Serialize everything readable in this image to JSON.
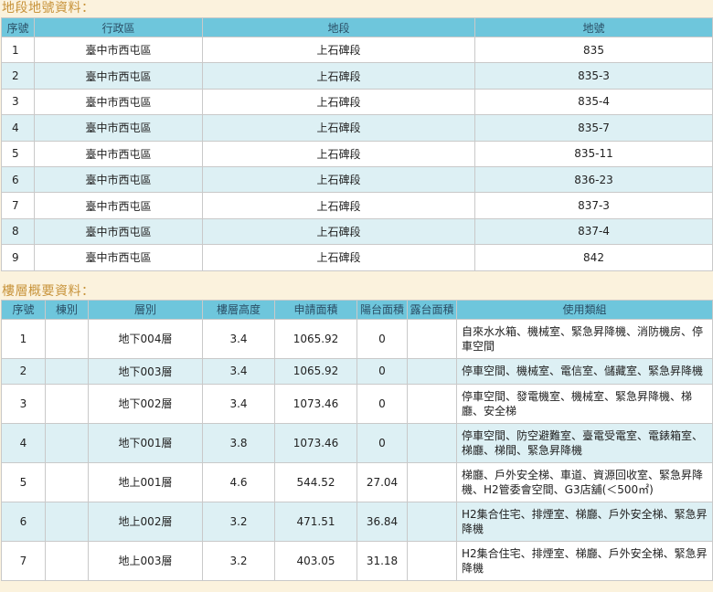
{
  "lot_section": {
    "title": "地段地號資料：",
    "headers": [
      "序號",
      "行政區",
      "地段",
      "地號"
    ],
    "rows": [
      [
        "1",
        "臺中市西屯區",
        "上石碑段",
        "835"
      ],
      [
        "2",
        "臺中市西屯區",
        "上石碑段",
        "835-3"
      ],
      [
        "3",
        "臺中市西屯區",
        "上石碑段",
        "835-4"
      ],
      [
        "4",
        "臺中市西屯區",
        "上石碑段",
        "835-7"
      ],
      [
        "5",
        "臺中市西屯區",
        "上石碑段",
        "835-11"
      ],
      [
        "6",
        "臺中市西屯區",
        "上石碑段",
        "836-23"
      ],
      [
        "7",
        "臺中市西屯區",
        "上石碑段",
        "837-3"
      ],
      [
        "8",
        "臺中市西屯區",
        "上石碑段",
        "837-4"
      ],
      [
        "9",
        "臺中市西屯區",
        "上石碑段",
        "842"
      ]
    ]
  },
  "floor_section": {
    "title": "樓層概要資料：",
    "headers": [
      "序號",
      "棟別",
      "層別",
      "樓層高度",
      "申請面積",
      "陽台面積",
      "露台面積",
      "使用類組"
    ],
    "rows": [
      [
        "1",
        "",
        "地下004層",
        "3.4",
        "1065.92",
        "0",
        "",
        "自來水水箱、機械室、緊急昇降機、消防機房、停車空間"
      ],
      [
        "2",
        "",
        "地下003層",
        "3.4",
        "1065.92",
        "0",
        "",
        "停車空間、機械室、電信室、儲藏室、緊急昇降機"
      ],
      [
        "3",
        "",
        "地下002層",
        "3.4",
        "1073.46",
        "0",
        "",
        "停車空間、發電機室、機械室、緊急昇降機、梯廳、安全梯"
      ],
      [
        "4",
        "",
        "地下001層",
        "3.8",
        "1073.46",
        "0",
        "",
        "停車空間、防空避難室、臺電受電室、電錶箱室、梯廳、梯間、緊急昇降機"
      ],
      [
        "5",
        "",
        "地上001層",
        "4.6",
        "544.52",
        "27.04",
        "",
        "梯廳、戶外安全梯、車道、資源回收室、緊急昇降機、H2管委會空間、G3店舖(＜500㎡)"
      ],
      [
        "6",
        "",
        "地上002層",
        "3.2",
        "471.51",
        "36.84",
        "",
        "H2集合住宅、排煙室、梯廳、戶外安全梯、緊急昇降機"
      ],
      [
        "7",
        "",
        "地上003層",
        "3.2",
        "403.05",
        "31.18",
        "",
        "H2集合住宅、排煙室、梯廳、戶外安全梯、緊急昇降機"
      ]
    ]
  }
}
